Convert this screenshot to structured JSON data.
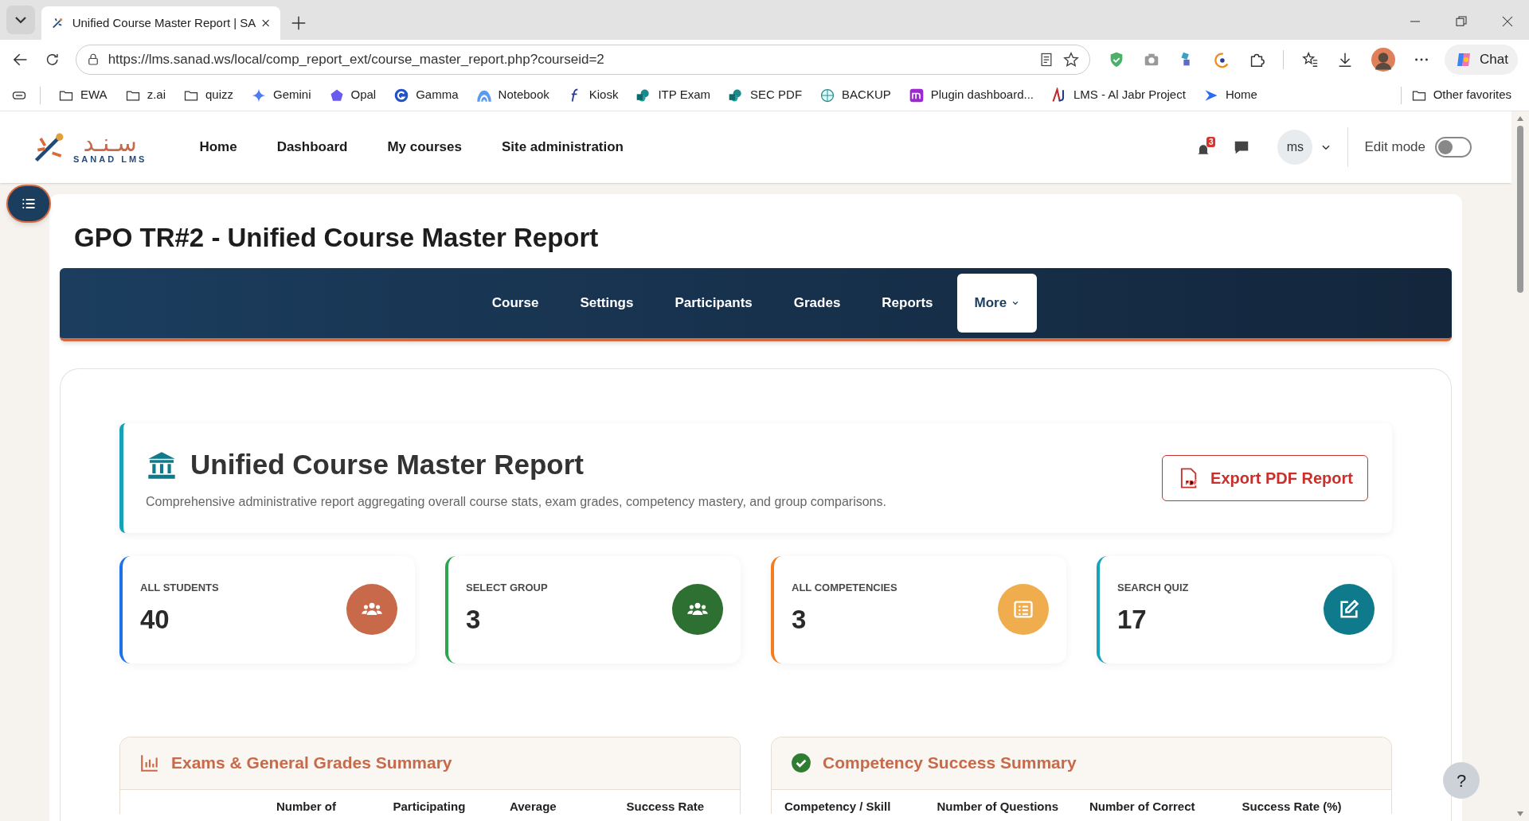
{
  "browser": {
    "tab_title": "Unified Course Master Report | SA",
    "url": "https://lms.sanad.ws/local/comp_report_ext/course_master_report.php?courseid=2",
    "chat_label": "Chat",
    "bookmarks": [
      {
        "label": "EWA",
        "kind": "folder"
      },
      {
        "label": "z.ai",
        "kind": "folder"
      },
      {
        "label": "quizz",
        "kind": "folder"
      },
      {
        "label": "Gemini",
        "kind": "star"
      },
      {
        "label": "Opal",
        "kind": "pentagon"
      },
      {
        "label": "Gamma",
        "kind": "g"
      },
      {
        "label": "Notebook",
        "kind": "arc"
      },
      {
        "label": "Kiosk",
        "kind": "f"
      },
      {
        "label": "ITP Exam",
        "kind": "share"
      },
      {
        "label": "SEC PDF",
        "kind": "share"
      },
      {
        "label": "BACKUP",
        "kind": "globe"
      },
      {
        "label": "Plugin dashboard...",
        "kind": "m"
      },
      {
        "label": "LMS - Al Jabr Project",
        "kind": "aj"
      },
      {
        "label": "Home",
        "kind": "arrow"
      }
    ],
    "other_favorites": "Other favorites"
  },
  "header": {
    "logo_arabic": "سـنـد",
    "logo_text": "SANAD LMS",
    "nav": [
      {
        "label": "Home"
      },
      {
        "label": "Dashboard"
      },
      {
        "label": "My courses"
      },
      {
        "label": "Site administration"
      }
    ],
    "notification_count": "3",
    "user_initials": "ms",
    "edit_mode": {
      "label": "Edit mode",
      "on": false
    }
  },
  "page_title": "GPO TR#2 - Unified Course Master Report",
  "course_nav": [
    {
      "label": "Course",
      "selected": false
    },
    {
      "label": "Settings",
      "selected": false
    },
    {
      "label": "Participants",
      "selected": false
    },
    {
      "label": "Grades",
      "selected": false
    },
    {
      "label": "Reports",
      "selected": false
    },
    {
      "label": "More",
      "selected": true
    }
  ],
  "report": {
    "title": "Unified Course Master Report",
    "description": "Comprehensive administrative report aggregating overall course stats, exam grades, competency mastery, and group comparisons.",
    "export_button": "Export PDF Report"
  },
  "stats": [
    {
      "label": "ALL STUDENTS",
      "value": "40",
      "color": "#c8694a"
    },
    {
      "label": "SELECT GROUP",
      "value": "3",
      "color": "#2e7031"
    },
    {
      "label": "ALL COMPETENCIES",
      "value": "3",
      "color": "#f0ad4e"
    },
    {
      "label": "SEARCH QUIZ",
      "value": "17",
      "color": "#0f7a8c"
    }
  ],
  "sections": [
    {
      "title": "Exams & General Grades Summary",
      "columns": [
        "",
        "Number of",
        "Participating",
        "Average",
        "Success Rate"
      ]
    },
    {
      "title": "Competency Success Summary",
      "columns": [
        "Competency / Skill",
        "Number of Questions",
        "Number of Correct",
        "Success Rate (%)"
      ]
    }
  ],
  "help_button": "?"
}
